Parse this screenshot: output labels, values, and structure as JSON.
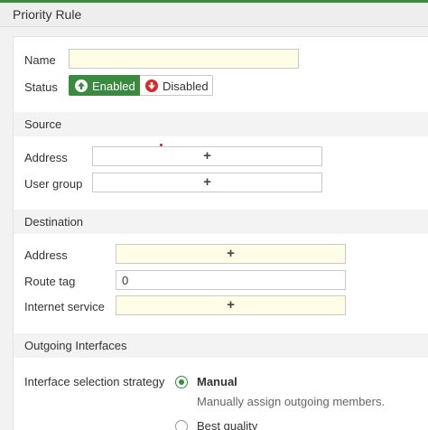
{
  "page": {
    "title": "Priority Rule"
  },
  "general": {
    "name_label": "Name",
    "name_value": "",
    "status_label": "Status",
    "status_enabled": "Enabled",
    "status_disabled": "Disabled"
  },
  "source": {
    "heading": "Source",
    "address_label": "Address",
    "user_group_label": "User group",
    "add_symbol": "+"
  },
  "destination": {
    "heading": "Destination",
    "address_label": "Address",
    "route_tag_label": "Route tag",
    "route_tag_value": "0",
    "internet_service_label": "Internet service",
    "add_symbol": "+"
  },
  "outgoing": {
    "heading": "Outgoing Interfaces",
    "strategy_label": "Interface selection strategy",
    "options": [
      {
        "label": "Manual",
        "description": "Manually assign outgoing members.",
        "selected": true
      },
      {
        "label": "Best quality",
        "selected": false
      }
    ]
  },
  "colors": {
    "accent": "#3a8a3f",
    "required_bg": "#fffde6",
    "disabled_icon": "#d32a2a"
  }
}
